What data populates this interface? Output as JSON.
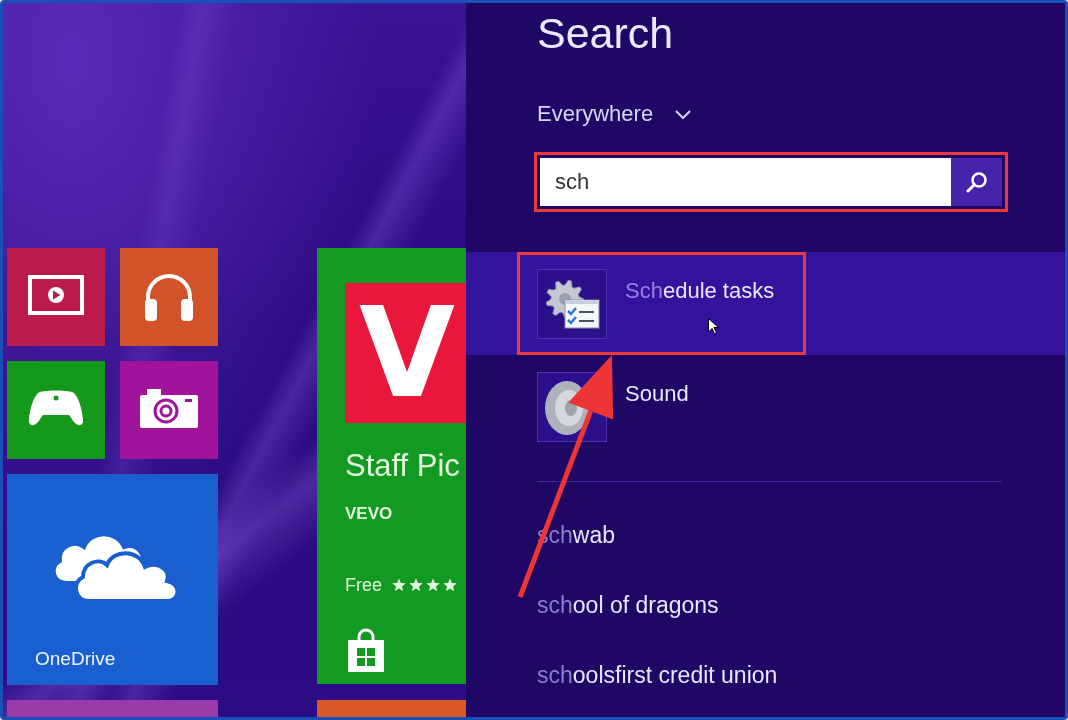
{
  "start_screen": {
    "groups": [
      {
        "tiles": [
          {
            "kind": "video",
            "color": "#b91c4a"
          },
          {
            "kind": "music",
            "color": "#d2532a"
          },
          {
            "kind": "games",
            "color": "#15991a"
          },
          {
            "kind": "camera",
            "color": "#a1139b"
          },
          {
            "kind": "onedrive",
            "color": "#1a5fd0",
            "label": "OneDrive"
          },
          {
            "kind": "partial",
            "color": "#9a3aa8"
          }
        ]
      },
      {
        "tiles": [
          {
            "kind": "store",
            "color": "#129a22",
            "logo_text": "V",
            "title": "Staff Pic",
            "publisher": "VEVO",
            "price": "Free",
            "stars": 4
          },
          {
            "kind": "partial",
            "color": "#d8582c"
          }
        ]
      }
    ]
  },
  "search_pane": {
    "title": "Search",
    "scope": "Everywhere",
    "search_box": {
      "value": "sch",
      "outlined": true
    },
    "results": [
      {
        "kind": "scheduler",
        "typed": "Sch",
        "completion": "edule tasks",
        "selected": true,
        "hovered": true,
        "outlined": true
      },
      {
        "kind": "sound",
        "completion": "Sound",
        "selected": false,
        "hovered": false,
        "outlined": false
      }
    ],
    "suggestions": [
      {
        "typed": "sch",
        "completion": "wab"
      },
      {
        "typed": "sch",
        "completion": "ool of dragons"
      },
      {
        "typed": "sch",
        "completion": "oolsfirst credit union"
      }
    ],
    "pointer_arrow": true
  }
}
